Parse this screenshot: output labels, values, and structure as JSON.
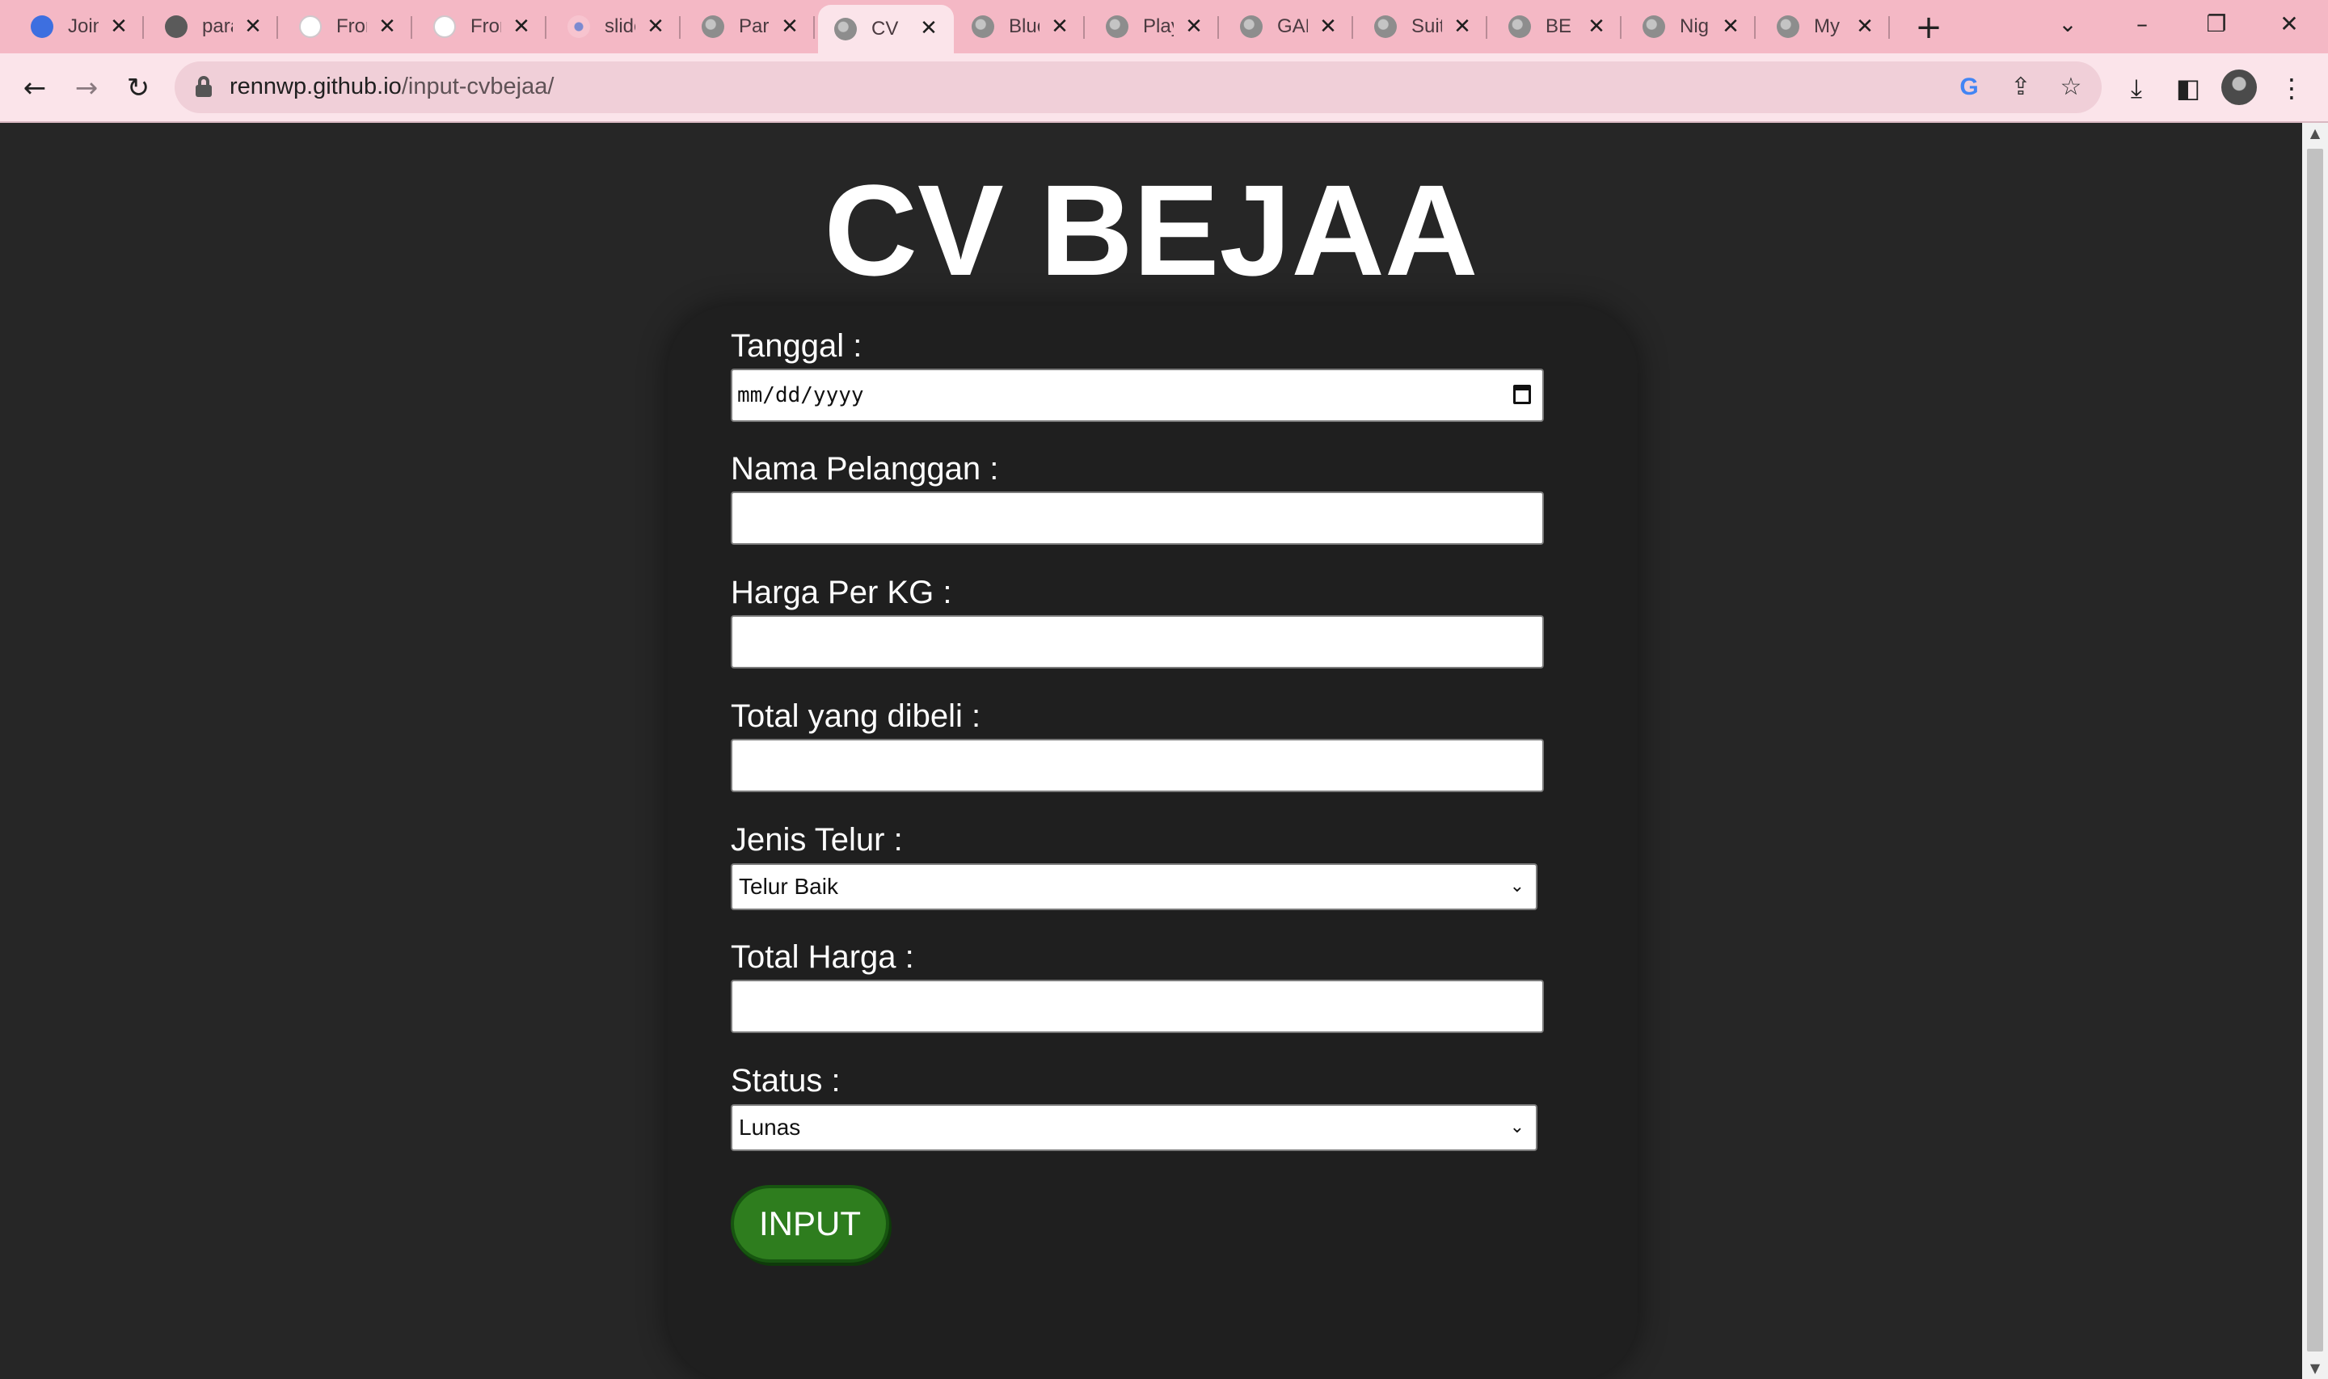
{
  "browser": {
    "tabs": [
      {
        "label": "Join",
        "icon": "join-icon"
      },
      {
        "label": "para",
        "icon": "github-icon"
      },
      {
        "label": "From",
        "icon": "frontend-icon"
      },
      {
        "label": "From",
        "icon": "frontend-icon"
      },
      {
        "label": "slide",
        "icon": "slide-icon"
      },
      {
        "label": "Para",
        "icon": "globe-icon"
      },
      {
        "label": "CV",
        "icon": "globe-icon",
        "active": true
      },
      {
        "label": "Blue",
        "icon": "globe-icon"
      },
      {
        "label": "Play",
        "icon": "globe-icon"
      },
      {
        "label": "GAL",
        "icon": "globe-icon"
      },
      {
        "label": "Suit",
        "icon": "globe-icon"
      },
      {
        "label": "BE",
        "icon": "globe-icon"
      },
      {
        "label": "Nig",
        "icon": "globe-icon"
      },
      {
        "label": "My",
        "icon": "globe-icon"
      }
    ],
    "url_host": "rennwp.github.io",
    "url_path": "/input-cvbejaa/",
    "tab_strip_color": "#f4b8c5",
    "toolbar_color": "#fbe4ea"
  },
  "page": {
    "title": "CV BEJAA",
    "background": "#262626",
    "form": {
      "tanggal_label": "Tanggal :",
      "tanggal_placeholder": "mm/dd/yyyy",
      "nama_label": "Nama Pelanggan :",
      "harga_label": "Harga Per KG :",
      "total_dibeli_label": "Total yang dibeli :",
      "jenis_label": "Jenis Telur :",
      "jenis_value": "Telur Baik",
      "total_harga_label": "Total Harga :",
      "status_label": "Status :",
      "status_value": "Lunas",
      "submit_label": "INPUT",
      "submit_color": "#2e7d1e"
    }
  }
}
